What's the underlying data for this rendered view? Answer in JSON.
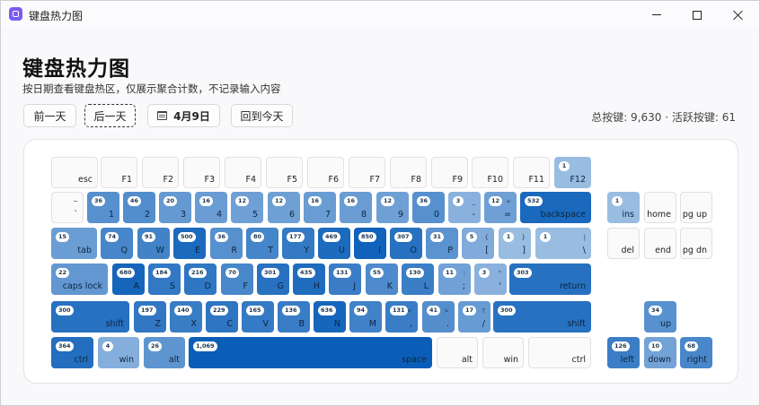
{
  "window": {
    "title": "键盘热力图"
  },
  "header": {
    "title": "键盘热力图",
    "subtitle": "按日期查看键盘热区，仅展示聚合计数，不记录输入内容",
    "prev_label": "前一天",
    "next_label": "后一天",
    "date_label": "4月9日",
    "today_label": "回到今天",
    "summary": "总按键: 9,630 · 活跃按键: 61"
  },
  "colors": {
    "base": "#ffffff",
    "heat_low": "#a9c6e6",
    "heat_high": "#0a5eb8",
    "idle_key": "#fafafa"
  },
  "keys": [
    {
      "id": "esc",
      "label": "esc"
    },
    {
      "id": "f1",
      "label": "F1"
    },
    {
      "id": "f2",
      "label": "F2"
    },
    {
      "id": "f3",
      "label": "F3"
    },
    {
      "id": "f4",
      "label": "F4"
    },
    {
      "id": "f5",
      "label": "F5"
    },
    {
      "id": "f6",
      "label": "F6"
    },
    {
      "id": "f7",
      "label": "F7"
    },
    {
      "id": "f8",
      "label": "F8"
    },
    {
      "id": "f9",
      "label": "F9"
    },
    {
      "id": "f10",
      "label": "F10"
    },
    {
      "id": "f11",
      "label": "F11"
    },
    {
      "id": "f12",
      "label": "F12",
      "count": "1"
    },
    {
      "id": "backtick",
      "label": "`",
      "sub": "~"
    },
    {
      "id": "d1",
      "label": "1",
      "count": "36"
    },
    {
      "id": "d2",
      "label": "2",
      "count": "46"
    },
    {
      "id": "d3",
      "label": "3",
      "count": "20"
    },
    {
      "id": "d4",
      "label": "4",
      "count": "16"
    },
    {
      "id": "d5",
      "label": "5",
      "count": "12"
    },
    {
      "id": "d6",
      "label": "6",
      "count": "12"
    },
    {
      "id": "d7",
      "label": "7",
      "count": "16"
    },
    {
      "id": "d8",
      "label": "8",
      "count": "16"
    },
    {
      "id": "d9",
      "label": "9",
      "count": "12"
    },
    {
      "id": "d0",
      "label": "0",
      "count": "36"
    },
    {
      "id": "minus",
      "label": "-",
      "sub": "_",
      "count": "3"
    },
    {
      "id": "equal",
      "label": "=",
      "sub": "+",
      "count": "12"
    },
    {
      "id": "backspace",
      "label": "backspace",
      "count": "532"
    },
    {
      "id": "tab",
      "label": "tab",
      "count": "15"
    },
    {
      "id": "q",
      "label": "Q",
      "count": "74"
    },
    {
      "id": "w",
      "label": "W",
      "count": "91"
    },
    {
      "id": "e",
      "label": "E",
      "count": "500"
    },
    {
      "id": "r",
      "label": "R",
      "count": "36"
    },
    {
      "id": "t",
      "label": "T",
      "count": "80"
    },
    {
      "id": "y",
      "label": "Y",
      "count": "177"
    },
    {
      "id": "u",
      "label": "U",
      "count": "469"
    },
    {
      "id": "i",
      "label": "I",
      "count": "850"
    },
    {
      "id": "o",
      "label": "O",
      "count": "307"
    },
    {
      "id": "p",
      "label": "P",
      "count": "31"
    },
    {
      "id": "lbracket",
      "label": "[",
      "sub": "{",
      "count": "5"
    },
    {
      "id": "rbracket",
      "label": "]",
      "sub": "}",
      "count": "1"
    },
    {
      "id": "backslash",
      "label": "\\",
      "sub": "|",
      "count": "1"
    },
    {
      "id": "caps",
      "label": "caps lock",
      "count": "22"
    },
    {
      "id": "a",
      "label": "A",
      "count": "680"
    },
    {
      "id": "s",
      "label": "S",
      "count": "184"
    },
    {
      "id": "d",
      "label": "D",
      "count": "216"
    },
    {
      "id": "f",
      "label": "F",
      "count": "70"
    },
    {
      "id": "g",
      "label": "G",
      "count": "301"
    },
    {
      "id": "h",
      "label": "H",
      "count": "435"
    },
    {
      "id": "j",
      "label": "J",
      "count": "131"
    },
    {
      "id": "k",
      "label": "K",
      "count": "55"
    },
    {
      "id": "l",
      "label": "L",
      "count": "130"
    },
    {
      "id": "semicolon",
      "label": ";",
      "sub": ":",
      "count": "11"
    },
    {
      "id": "quote",
      "label": "'",
      "sub": "\"",
      "count": "3"
    },
    {
      "id": "return",
      "label": "return",
      "count": "303"
    },
    {
      "id": "lshift",
      "label": "shift",
      "count": "300"
    },
    {
      "id": "z",
      "label": "Z",
      "count": "197"
    },
    {
      "id": "x",
      "label": "X",
      "count": "140"
    },
    {
      "id": "c",
      "label": "C",
      "count": "229"
    },
    {
      "id": "v",
      "label": "V",
      "count": "165"
    },
    {
      "id": "b",
      "label": "B",
      "count": "136"
    },
    {
      "id": "n",
      "label": "N",
      "count": "636"
    },
    {
      "id": "m",
      "label": "M",
      "count": "94"
    },
    {
      "id": "comma",
      "label": ",",
      "sub": "<",
      "count": "131"
    },
    {
      "id": "period",
      "label": ".",
      "sub": ">",
      "count": "41"
    },
    {
      "id": "slash",
      "label": "/",
      "sub": "?",
      "count": "17"
    },
    {
      "id": "rshift",
      "label": "shift",
      "count": "300"
    },
    {
      "id": "lctrl",
      "label": "ctrl",
      "count": "364"
    },
    {
      "id": "lwin",
      "label": "win",
      "count": "4"
    },
    {
      "id": "lalt",
      "label": "alt",
      "count": "26"
    },
    {
      "id": "space",
      "label": "space",
      "count": "1,069"
    },
    {
      "id": "ralt",
      "label": "alt"
    },
    {
      "id": "rwin",
      "label": "win"
    },
    {
      "id": "rctrl",
      "label": "ctrl"
    },
    {
      "id": "ins",
      "label": "ins",
      "count": "1"
    },
    {
      "id": "home",
      "label": "home"
    },
    {
      "id": "pgup",
      "label": "pg up"
    },
    {
      "id": "del",
      "label": "del"
    },
    {
      "id": "end",
      "label": "end"
    },
    {
      "id": "pgdn",
      "label": "pg dn"
    },
    {
      "id": "up",
      "label": "up",
      "count": "34"
    },
    {
      "id": "left",
      "label": "left",
      "count": "126"
    },
    {
      "id": "down",
      "label": "down",
      "count": "10"
    },
    {
      "id": "right",
      "label": "right",
      "count": "68"
    }
  ]
}
